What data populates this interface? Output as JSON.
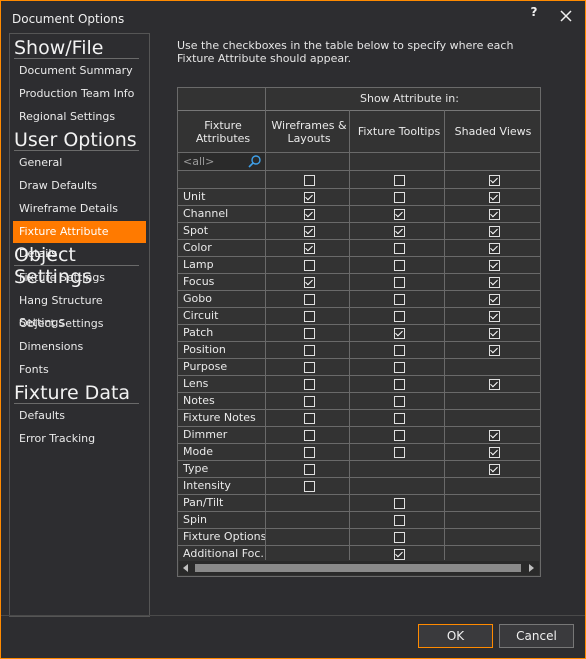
{
  "window": {
    "title": "Document Options",
    "help": "?"
  },
  "sidebar": {
    "sections": [
      {
        "title": "Show/File",
        "items": [
          "Document Summary",
          "Production Team Info",
          "Regional Settings"
        ]
      },
      {
        "title": "User Options",
        "items": [
          "General",
          "Draw Defaults",
          "Wireframe Details",
          "Fixture Attribute Details"
        ]
      },
      {
        "title": "Object Settings",
        "items": [
          "Fixture Settings",
          "Hang Structure Settings",
          "Object Settings",
          "Dimensions",
          "Fonts"
        ]
      },
      {
        "title": "Fixture Data",
        "items": [
          "Defaults",
          "Error Tracking"
        ]
      }
    ],
    "active_item": "Fixture Attribute Details"
  },
  "main": {
    "description": "Use the checkboxes in the table below to specify where each Fixture Attribute should appear.",
    "group_header": "Show Attribute in:",
    "columns": {
      "attribute": "Fixture Attributes",
      "wireframes": "Wireframes & Layouts",
      "tooltips": "Fixture Tooltips",
      "shaded": "Shaded Views"
    },
    "filter_placeholder": "<all>",
    "all_row": {
      "wireframes": false,
      "tooltips": false,
      "shaded": true
    },
    "rows": [
      {
        "name": "Unit",
        "w": true,
        "t": false,
        "s": true
      },
      {
        "name": "Channel",
        "w": true,
        "t": true,
        "s": true
      },
      {
        "name": "Spot",
        "w": true,
        "t": true,
        "s": true
      },
      {
        "name": "Color",
        "w": true,
        "t": false,
        "s": true
      },
      {
        "name": "Lamp",
        "w": false,
        "t": false,
        "s": true
      },
      {
        "name": "Focus",
        "w": true,
        "t": false,
        "s": true
      },
      {
        "name": "Gobo",
        "w": false,
        "t": false,
        "s": true
      },
      {
        "name": "Circuit",
        "w": false,
        "t": false,
        "s": true
      },
      {
        "name": "Patch",
        "w": false,
        "t": true,
        "s": true
      },
      {
        "name": "Position",
        "w": false,
        "t": false,
        "s": true
      },
      {
        "name": "Purpose",
        "w": false,
        "t": false,
        "s": null
      },
      {
        "name": "Lens",
        "w": false,
        "t": false,
        "s": true
      },
      {
        "name": "Notes",
        "w": false,
        "t": false,
        "s": null
      },
      {
        "name": "Fixture Notes",
        "w": false,
        "t": false,
        "s": null
      },
      {
        "name": "Dimmer",
        "w": false,
        "t": false,
        "s": true
      },
      {
        "name": "Mode",
        "w": false,
        "t": false,
        "s": true
      },
      {
        "name": "Type",
        "w": false,
        "t": null,
        "s": true
      },
      {
        "name": "Intensity",
        "w": false,
        "t": null,
        "s": null
      },
      {
        "name": "Pan/Tilt",
        "w": null,
        "t": false,
        "s": null
      },
      {
        "name": "Spin",
        "w": null,
        "t": false,
        "s": null
      },
      {
        "name": "Fixture Options",
        "w": null,
        "t": false,
        "s": null
      },
      {
        "name": "Additional Foc...",
        "w": null,
        "t": true,
        "s": null
      }
    ]
  },
  "buttons": {
    "ok": "OK",
    "cancel": "Cancel"
  },
  "colors": {
    "accent": "#ff7a00",
    "background": "#2d2d30"
  }
}
